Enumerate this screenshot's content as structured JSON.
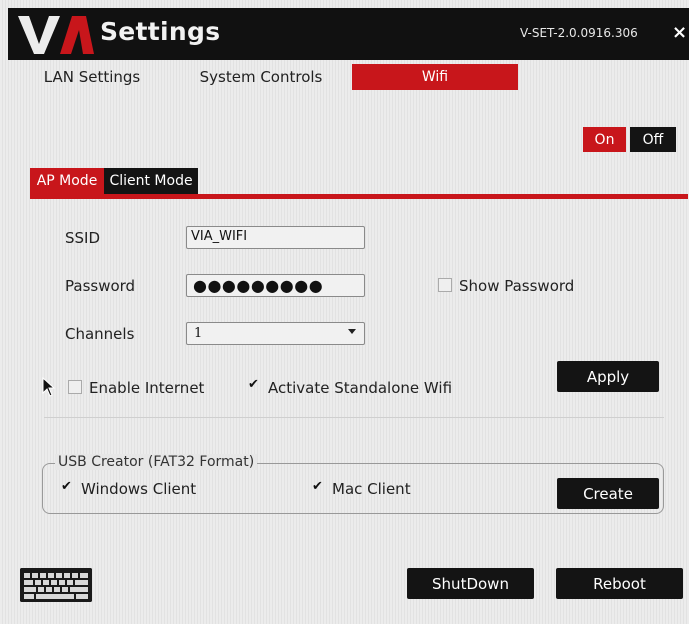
{
  "window": {
    "title": "Settings",
    "logo_text": "VIA",
    "version": "V-SET-2.0.0916.306",
    "close_label": "×"
  },
  "tabs": [
    {
      "label": "LAN Settings",
      "active": false
    },
    {
      "label": "System Controls",
      "active": false
    },
    {
      "label": "Wifi",
      "active": true
    }
  ],
  "wifi_toggle": {
    "on_label": "On",
    "off_label": "Off",
    "state": "On"
  },
  "subtabs": [
    {
      "label": "AP Mode",
      "active": true
    },
    {
      "label": "Client Mode",
      "active": false
    }
  ],
  "form": {
    "ssid_label": "SSID",
    "ssid_value": "VIA_WIFI",
    "password_label": "Password",
    "password_mask": "●●●●●●●●●",
    "show_password_label": "Show Password",
    "show_password_checked": false,
    "channels_label": "Channels",
    "channels_value": "1",
    "enable_internet_label": "Enable Internet",
    "enable_internet_checked": false,
    "standalone_label": "Activate Standalone Wifi",
    "standalone_checked": true,
    "apply_label": "Apply"
  },
  "usb_creator": {
    "legend": "USB Creator (FAT32 Format)",
    "windows_label": "Windows Client",
    "windows_checked": true,
    "mac_label": "Mac Client",
    "mac_checked": true,
    "create_label": "Create"
  },
  "footer": {
    "shutdown_label": "ShutDown",
    "reboot_label": "Reboot",
    "keyboard_icon": "keyboard-icon"
  },
  "colors": {
    "accent": "#c8161b",
    "dark": "#141414"
  },
  "checkmark": "✔"
}
